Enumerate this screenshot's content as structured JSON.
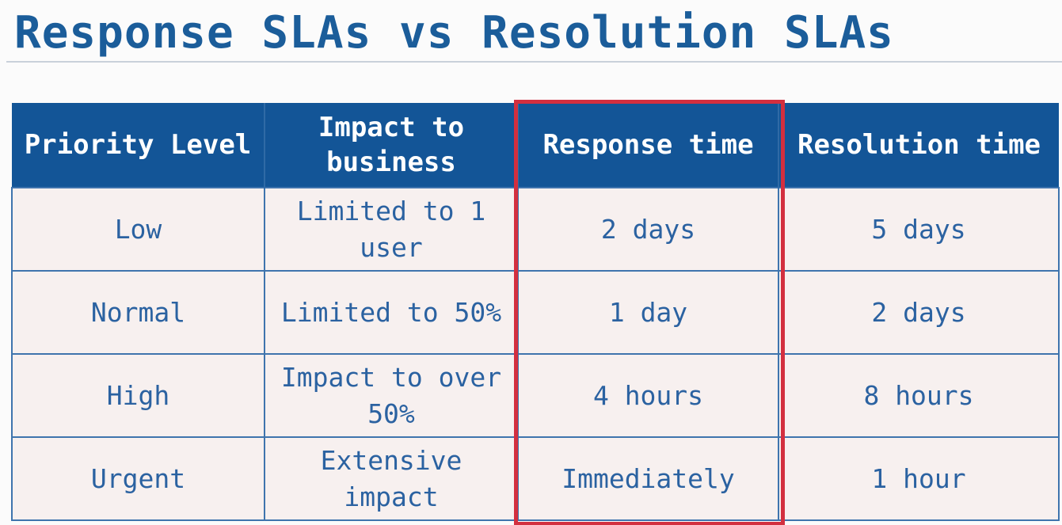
{
  "title": "Response SLAs vs Resolution SLAs",
  "table": {
    "headers": [
      "Priority Level",
      "Impact to business",
      "Response time",
      "Resolution time"
    ],
    "rows": [
      [
        "Low",
        "Limited to 1 user",
        "2 days",
        "5 days"
      ],
      [
        "Normal",
        "Limited to 50%",
        "1 day",
        "2 days"
      ],
      [
        "High",
        "Impact to over 50%",
        "4 hours",
        "8 hours"
      ],
      [
        "Urgent",
        "Extensive impact",
        "Immediately",
        "1 hour"
      ]
    ]
  },
  "colors": {
    "title": "#1b5d9a",
    "header_bg": "#135597",
    "cell_bg": "#f7f0ef",
    "cell_text": "#2b62a1",
    "highlight": "#d32f3f"
  }
}
